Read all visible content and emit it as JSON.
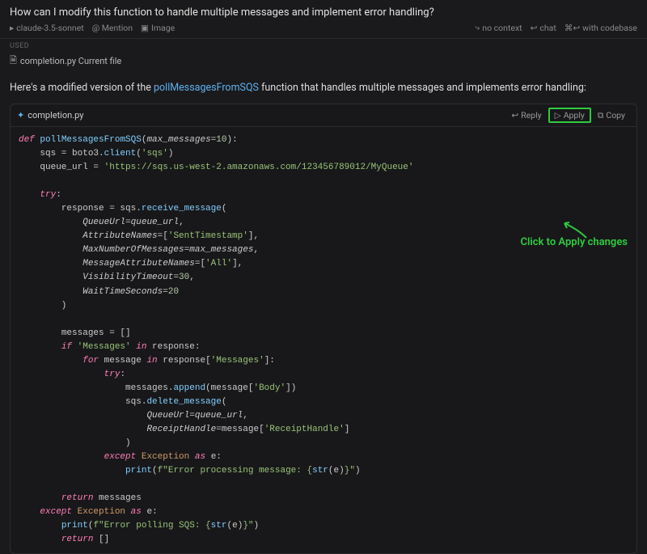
{
  "header": {
    "query": "How can I modify this function to handle multiple messages and implement error handling?",
    "model": "claude-3.5-sonnet",
    "mention": "@ Mention",
    "image": "Image",
    "no_context": "no context",
    "chat": "chat",
    "codebase": "with codebase"
  },
  "used": {
    "label": "USED",
    "file": "completion.py Current file"
  },
  "intro": {
    "prefix": "Here's a modified version of the ",
    "fn": "pollMessagesFromSQS",
    "suffix": " function that handles multiple messages and implements error handling:"
  },
  "code_header": {
    "file": "completion.py",
    "reply": "Reply",
    "apply": "Apply",
    "copy": "Copy"
  },
  "annotation": "Click to Apply changes",
  "code": {
    "def": "def",
    "fn_name": "pollMessagesFromSQS",
    "param1": "max_messages",
    "defv": "10",
    "l2a": "sqs = boto3.",
    "l2b": "client",
    "l2c": "'sqs'",
    "l3a": "queue_url = ",
    "l3b": "'https://sqs.us-west-2.amazonaws.com/123456789012/MyQueue'",
    "try": "try",
    "l5a": "response = sqs.",
    "l5b": "receive_message",
    "k_QueueUrl": "QueueUrl",
    "v_queue_url": "queue_url",
    "k_AttrNames": "AttributeNames",
    "v_SentTs": "'SentTimestamp'",
    "k_MaxNum": "MaxNumberOfMessages",
    "v_maxmsg": "max_messages",
    "k_MsgAttr": "MessageAttributeNames",
    "v_All": "'All'",
    "k_Vis": "VisibilityTimeout",
    "v_30": "30",
    "k_Wait": "WaitTimeSeconds",
    "v_20": "20",
    "l13": "messages = []",
    "if": "if",
    "l14a": "'Messages'",
    "in": "in",
    "l14b": " response:",
    "for": "for",
    "l15a": " message ",
    "l15b": " response[",
    "l15c": "'Messages'",
    "l15d": "]:",
    "l17a": "messages.",
    "l17b": "append",
    "l17c": "(message[",
    "l17d": "'Body'",
    "l17e": "])",
    "l18a": "sqs.",
    "l18b": "delete_message",
    "v_queue_url2": "queue_url",
    "k_Receipt": "ReceiptHandle",
    "l20a": "message[",
    "l20b": "'ReceiptHandle'",
    "l20c": "]",
    "except": "except",
    "Exception": "Exception",
    "as": "as",
    "e": "e",
    "l22a": "print",
    "l22b": "f\"Error processing message: {",
    "l22c": "str",
    "l22d": "e",
    "l22e": "}\"",
    "return": "return",
    "l24": " messages",
    "l26a": "print",
    "l26b": "f\"Error polling SQS: {",
    "l26c": "str",
    "l26d": "e",
    "l26e": "}\"",
    "l27": " []"
  }
}
